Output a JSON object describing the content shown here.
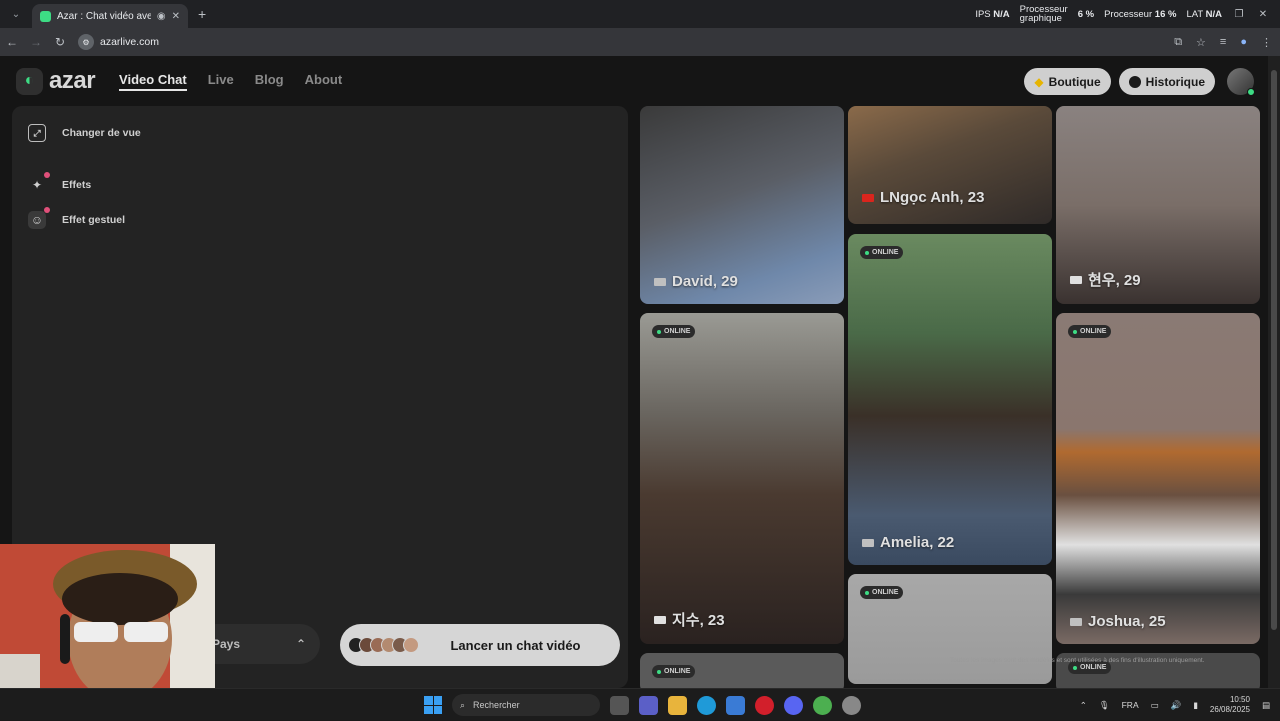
{
  "browser": {
    "tab_title": "Azar : Chat vidéo avec de n",
    "url": "azarlive.com",
    "stats": {
      "ips_label": "IPS",
      "ips_value": "N/A",
      "gpu_label_1": "Processeur",
      "gpu_label_2": "graphique",
      "gpu_value": "6 %",
      "cpu_label": "Processeur",
      "cpu_value": "16 %",
      "lat_label": "LAT",
      "lat_value": "N/A"
    }
  },
  "header": {
    "logo_text": "azar",
    "nav": [
      {
        "label": "Video Chat",
        "active": true
      },
      {
        "label": "Live"
      },
      {
        "label": "Blog"
      },
      {
        "label": "About"
      }
    ],
    "boutique_label": "Boutique",
    "historique_label": "Historique"
  },
  "panel": {
    "tools": [
      {
        "label": "Changer de vue",
        "icon": "expand-icon"
      },
      {
        "label": "Effets",
        "icon": "sparkle-icon"
      },
      {
        "label": "Effet gestuel",
        "icon": "smiley-icon"
      }
    ],
    "country_label": "Pays",
    "launch_label": "Lancer un chat vidéo"
  },
  "cards": [
    {
      "name": "David, 29",
      "online": false,
      "flag_color": "#c0c0c0"
    },
    {
      "name": "LNgọc Anh, 23",
      "online": false,
      "flag_color": "#da251d"
    },
    {
      "name": "현우, 29",
      "online": false,
      "flag_color": "#e0e0e0"
    },
    {
      "name": "지수, 23",
      "online": true,
      "flag_color": "#e0e0e0"
    },
    {
      "name": "Amelia, 22",
      "online": true,
      "flag_color": "#c0c0c0"
    },
    {
      "name": "Joshua, 25",
      "online": true,
      "flag_color": "#c0c0c0"
    },
    {
      "name": "",
      "online": true
    },
    {
      "name": "",
      "online": true
    },
    {
      "name": "",
      "online": true
    }
  ],
  "online_label": "ONLINE",
  "disclaimer": "Toutes les images sont des modèles et sont utilisées à des fins d'illustration uniquement.",
  "taskbar": {
    "search_placeholder": "Rechercher",
    "lang": "FRA",
    "time": "10:50",
    "date": "26/08/2025"
  },
  "colors": {
    "accent": "#3ddc84",
    "badge": "#e0507a"
  }
}
